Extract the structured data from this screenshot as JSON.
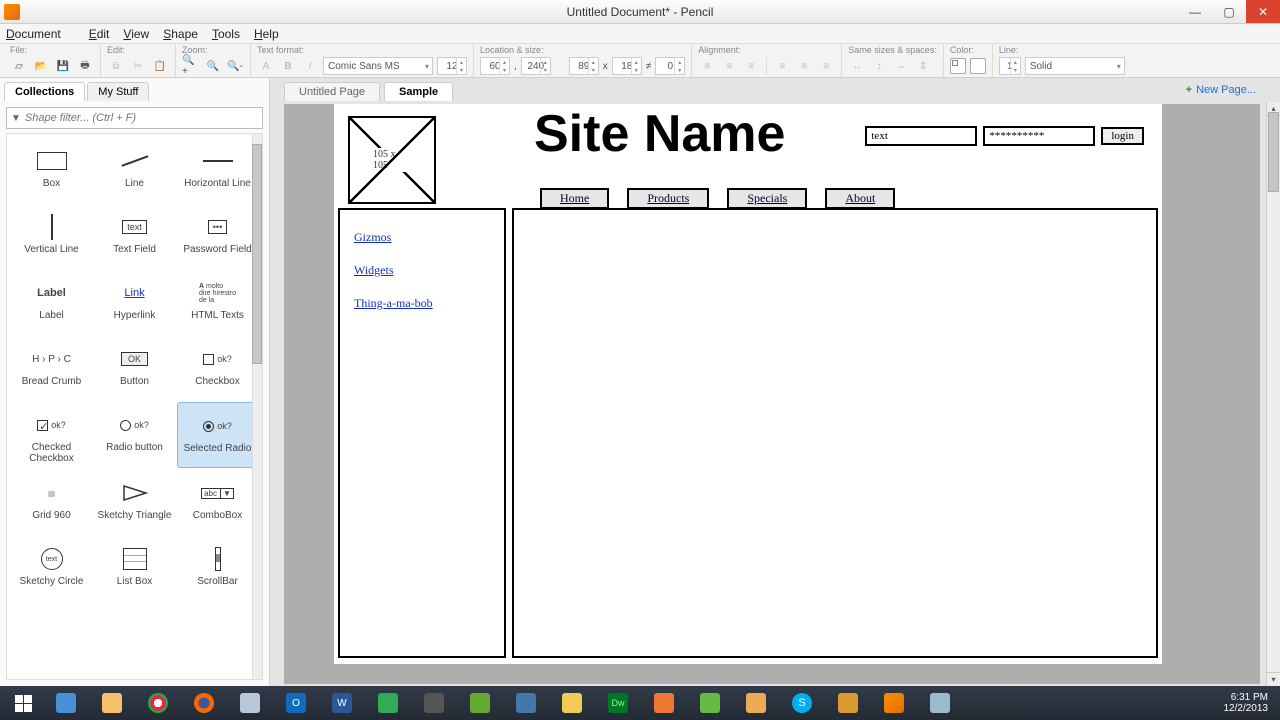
{
  "window": {
    "title": "Untitled Document* - Pencil"
  },
  "menu": [
    "Document",
    "Edit",
    "View",
    "Shape",
    "Tools",
    "Help"
  ],
  "toolbar": {
    "groups": {
      "file": {
        "label": "File:"
      },
      "edit": {
        "label": "Edit:"
      },
      "zoom": {
        "label": "Zoom:"
      },
      "text": {
        "label": "Text format:",
        "font": "Comic Sans MS",
        "size": "12"
      },
      "loc": {
        "label": "Location & size:",
        "x": "60",
        "y": "240",
        "w": "89",
        "h": "18",
        "a": "≠",
        "r": "0"
      },
      "align": {
        "label": "Alignment:"
      },
      "sizes": {
        "label": "Same sizes & spaces:"
      },
      "color": {
        "label": "Color:"
      },
      "line": {
        "label": "Line:",
        "w": "1",
        "style": "Solid"
      }
    }
  },
  "left": {
    "tabs": [
      "Collections",
      "My Stuff"
    ],
    "active_tab": 0,
    "filter_placeholder": "Shape filter... (Ctrl + F)",
    "shapes": [
      {
        "name": "Box"
      },
      {
        "name": "Line"
      },
      {
        "name": "Horizontal Line"
      },
      {
        "name": "Vertical Line"
      },
      {
        "name": "Text Field"
      },
      {
        "name": "Password Field"
      },
      {
        "name": "Label"
      },
      {
        "name": "Hyperlink"
      },
      {
        "name": "HTML Texts"
      },
      {
        "name": "Bread Crumb"
      },
      {
        "name": "Button"
      },
      {
        "name": "Checkbox"
      },
      {
        "name": "Checked Checkbox"
      },
      {
        "name": "Radio button"
      },
      {
        "name": "Selected Radio"
      },
      {
        "name": "Grid 960"
      },
      {
        "name": "Sketchy Triangle"
      },
      {
        "name": "ComboBox"
      },
      {
        "name": "Sketchy Circle"
      },
      {
        "name": "List Box"
      },
      {
        "name": "ScrollBar"
      }
    ],
    "selected_shape": 14
  },
  "doc_tabs": [
    "Untitled Page",
    "Sample"
  ],
  "active_doc_tab": 1,
  "new_page": "New Page...",
  "mockup": {
    "image_placeholder": "105 x 105",
    "title": "Site Name",
    "login_user": "text",
    "login_pass": "**********",
    "login_btn": "login",
    "nav": [
      "Home",
      "Products",
      "Specials",
      "About"
    ],
    "links": [
      "Gizmos",
      "Widgets",
      "Thing-a-ma-bob"
    ]
  },
  "clock": {
    "time": "6:31 PM",
    "date": "12/2/2013"
  }
}
